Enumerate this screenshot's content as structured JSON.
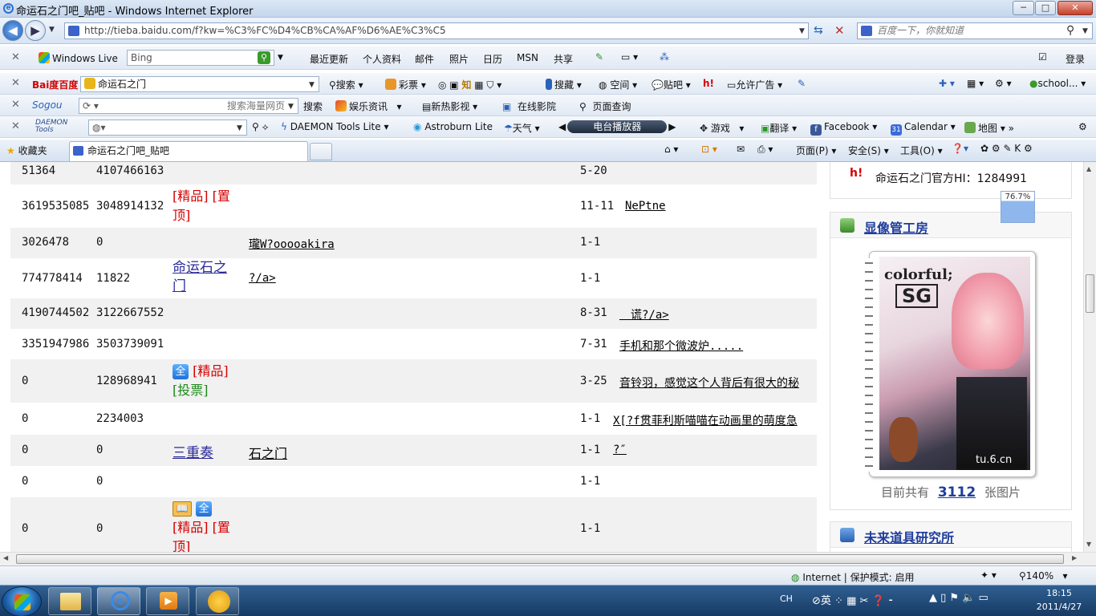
{
  "window": {
    "title": "命运石之门吧_贴吧 - Windows Internet Explorer",
    "minimize": "─",
    "maximize": "□",
    "close": "✕"
  },
  "address": {
    "url": "http://tieba.baidu.com/f?kw=%C3%FC%D4%CB%CA%AF%D6%AE%C3%C5",
    "search_placeholder": "百度一下，你就知道"
  },
  "toolbar_live": {
    "brand": "Windows Live",
    "search_value": "Bing",
    "items": [
      "最近更新",
      "个人资料",
      "邮件",
      "照片",
      "日历",
      "MSN",
      "共享"
    ],
    "login": "登录"
  },
  "toolbar_baidu": {
    "brand": "Bai度百度",
    "search_value": "命运石之门",
    "items": [
      "搜索",
      "彩票",
      "知",
      "搜藏",
      "空间",
      "贴吧",
      "允许广告",
      "school..."
    ]
  },
  "toolbar_sogou": {
    "brand": "Sogou",
    "search_placeholder": "搜索海量网页",
    "items": [
      "搜索",
      "娱乐资讯",
      "新热影视",
      "在线影院",
      "页面查询"
    ]
  },
  "toolbar_daemon": {
    "brand": "DAEMON Tools",
    "items": [
      "DAEMON Tools Lite",
      "Astroburn Lite",
      "天气",
      "电台播放器",
      "游戏",
      "翻译",
      "Facebook",
      "Calendar",
      "地图"
    ]
  },
  "favorites_bar": {
    "favorites": "收藏夹",
    "tab_title": "命运石之门吧_贴吧",
    "commands": [
      "页面(P)",
      "安全(S)",
      "工具(O)"
    ]
  },
  "threads": [
    {
      "id": "51364",
      "reply": "4107466163",
      "date": "5-20",
      "title": ""
    },
    {
      "id": "3619535085",
      "reply": "3048914132",
      "date": "11-11",
      "title": "NePtne"
    },
    {
      "id": "3026478",
      "reply": "0",
      "date": "1-1",
      "title": "",
      "author": "瓏W?ooooakira"
    },
    {
      "id": "774778414",
      "reply": "11822",
      "date": "1-1",
      "title": "",
      "forum": "命运石之门",
      "author": "?/a>"
    },
    {
      "id": "4190744502",
      "reply": "3122667552",
      "date": "8-31",
      "title": "　谎?/a>"
    },
    {
      "id": "3351947986",
      "reply": "3503739091",
      "date": "7-31",
      "title": "手机和那个微波炉....."
    },
    {
      "id": "0",
      "reply": "128968941",
      "date": "3-25",
      "title": "音铃羽，感觉这个人背后有很大的秘"
    },
    {
      "id": "0",
      "reply": "2234003",
      "date": "1-1",
      "title": "X[?f贯菲利斯喵喵在动画里的萌度急"
    },
    {
      "id": "0",
      "reply": "0",
      "date": "1-1",
      "title": "?″",
      "forum": "三重奏",
      "author": "石之门"
    },
    {
      "id": "0",
      "reply": "0",
      "date": "1-1",
      "title": ""
    },
    {
      "id": "0",
      "reply": "0",
      "date": "1-1",
      "title": ""
    }
  ],
  "tags": {
    "jingpin": "[精品]",
    "zhiding_1": "[置",
    "zhiding_2": "顶]",
    "toupiao": "[投票]",
    "quan": "全",
    "book": "📖"
  },
  "sidebar": {
    "official_hi": "命运石之门官方HI：1284991",
    "zoom_badge": "76.7%",
    "gallery_title": "显像管工房",
    "gallery_count_prefix": "目前共有",
    "gallery_count": "3112",
    "gallery_count_suffix": "张图片",
    "lab_title": "未来道具研究所",
    "cover_title": "colorful;",
    "cover_sub": "SG",
    "cover_watermark": "tu.6.cn"
  },
  "statusbar": {
    "zone": "Internet | 保护模式: 启用",
    "zoom": "140%"
  },
  "taskbar": {
    "ime": "CH",
    "ime2": "英",
    "time": "18:15",
    "date": "2011/4/27"
  },
  "colors": {
    "red_tag": "#d40000",
    "green_tag": "#1a8a1a",
    "link_blue": "#2a2a9a",
    "row_alt": "#f1f1f1"
  }
}
